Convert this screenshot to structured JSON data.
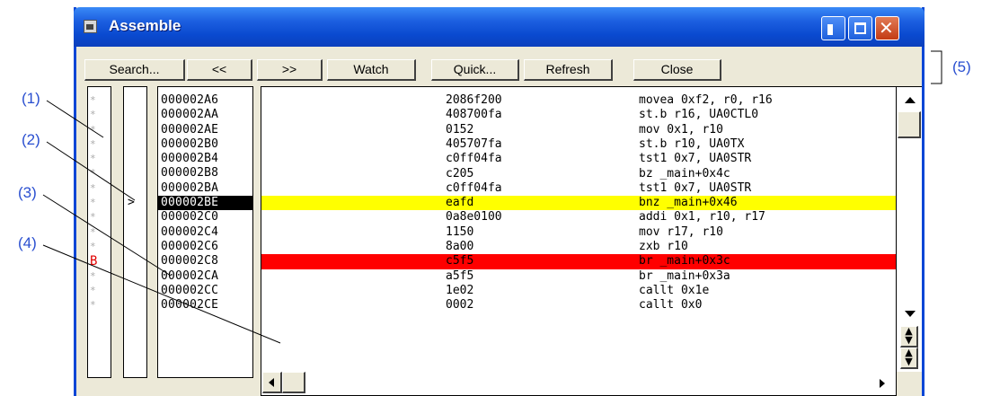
{
  "window": {
    "title": "Assemble"
  },
  "toolbar": {
    "buttons": [
      {
        "label": "Search..."
      },
      {
        "label": "<<"
      },
      {
        "label": ">>"
      },
      {
        "label": "Watch"
      },
      {
        "label": "Quick..."
      },
      {
        "label": "Refresh"
      },
      {
        "label": "Close"
      }
    ]
  },
  "columns": {
    "breakpoint_markers": [
      "*",
      "*",
      "*",
      "*",
      "*",
      "*",
      "*",
      "*",
      "*",
      "*",
      "*",
      "B",
      "*",
      "*",
      "*"
    ],
    "pc_markers": [
      "",
      "",
      "",
      "",
      "",
      "",
      "",
      ">",
      "",
      "",
      "",
      "",
      "",
      "",
      ""
    ],
    "addresses": [
      "000002A6",
      "000002AA",
      "000002AE",
      "000002B0",
      "000002B4",
      "000002B8",
      "000002BA",
      "000002BE",
      "000002C0",
      "000002C4",
      "000002C6",
      "000002C8",
      "000002CA",
      "000002CC",
      "000002CE"
    ]
  },
  "code": {
    "rows": [
      {
        "code": "2086f200",
        "mnemonic": "movea 0xf2, r0, r16",
        "state": "normal"
      },
      {
        "code": "408700fa",
        "mnemonic": "st.b r16, UA0CTL0",
        "state": "normal"
      },
      {
        "code": "0152",
        "mnemonic": "mov 0x1, r10",
        "state": "normal"
      },
      {
        "code": "405707fa",
        "mnemonic": "st.b r10, UA0TX",
        "state": "normal"
      },
      {
        "code": "c0ff04fa",
        "mnemonic": "tst1 0x7, UA0STR",
        "state": "normal"
      },
      {
        "code": "c205",
        "mnemonic": "bz _main+0x4c",
        "state": "normal"
      },
      {
        "code": "c0ff04fa",
        "mnemonic": "tst1 0x7, UA0STR",
        "state": "normal"
      },
      {
        "code": "eafd",
        "mnemonic": "bnz _main+0x46",
        "state": "current"
      },
      {
        "code": "0a8e0100",
        "mnemonic": "addi 0x1, r10, r17",
        "state": "normal"
      },
      {
        "code": "1150",
        "mnemonic": "mov r17, r10",
        "state": "normal"
      },
      {
        "code": "8a00",
        "mnemonic": "zxb r10",
        "state": "normal"
      },
      {
        "code": "c5f5",
        "mnemonic": "br _main+0x3c",
        "state": "breakpoint"
      },
      {
        "code": "a5f5",
        "mnemonic": "br _main+0x3a",
        "state": "normal"
      },
      {
        "code": "1e02",
        "mnemonic": "callt 0x1e",
        "state": "normal"
      },
      {
        "code": "0002",
        "mnemonic": "callt 0x0",
        "state": "normal"
      }
    ]
  },
  "callouts": {
    "c1": "(1)",
    "c2": "(2)",
    "c3": "(3)",
    "c4": "(4)",
    "c5": "(5)"
  },
  "colors": {
    "current_line": "#ffff00",
    "breakpoint_line": "#ff0000",
    "breakpoint_marker": "#e00000",
    "callout": "#2a4fd0",
    "titlebar": "#1c5fe0"
  }
}
